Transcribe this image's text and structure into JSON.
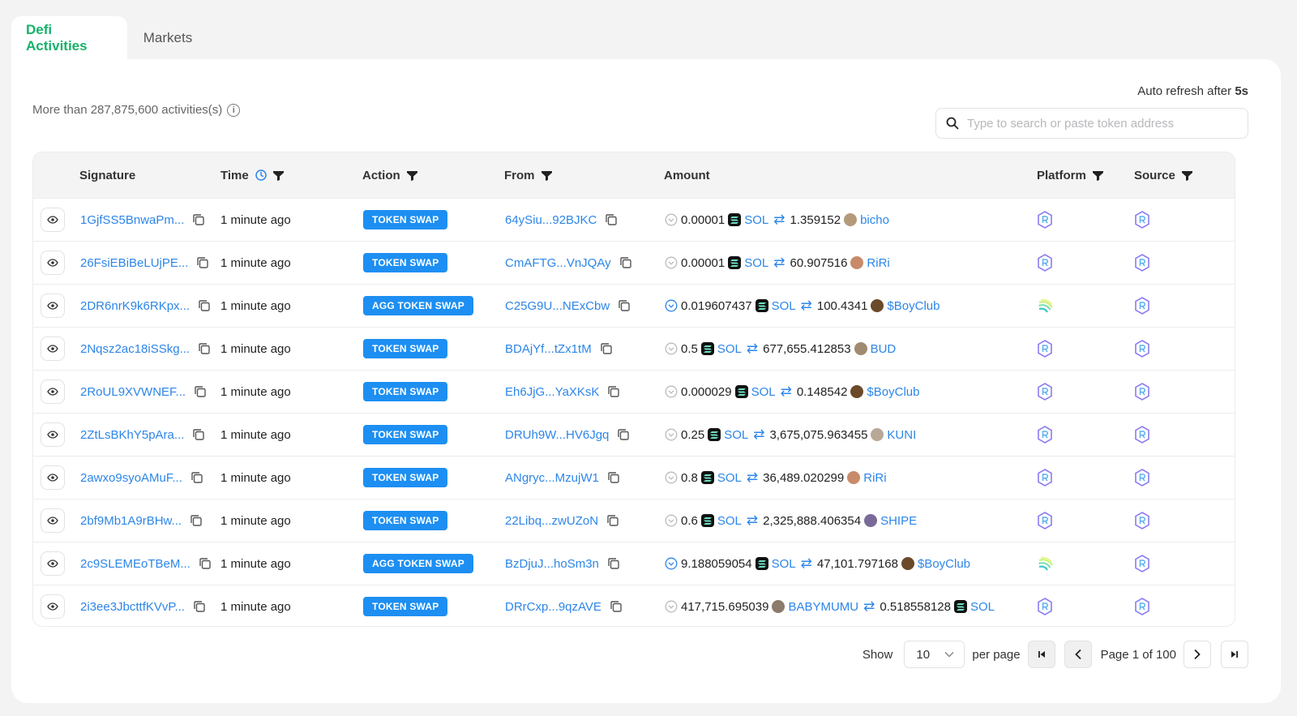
{
  "tabs": [
    {
      "label": "Defi Activities"
    },
    {
      "label": "Markets"
    }
  ],
  "summary": {
    "text": "More than 287,875,600 activities(s)"
  },
  "refresh": {
    "prefix": "Auto refresh after ",
    "value": "5s"
  },
  "search": {
    "placeholder": "Type to search or paste token address"
  },
  "columns": {
    "signature": "Signature",
    "time": "Time",
    "action": "Action",
    "from": "From",
    "amount": "Amount",
    "platform": "Platform",
    "source": "Source"
  },
  "colors": {
    "accent_green": "#17b26a",
    "link_blue": "#2d86e8",
    "badge_blue": "#1d8ff2"
  },
  "rows": [
    {
      "sig": "1GjfSS5BnwaPm...",
      "time": "1 minute ago",
      "action": "TOKEN SWAP",
      "from": "64ySiu...92BJKC",
      "a1": "0.00001",
      "t1": "SOL",
      "a2": "1.359152",
      "t2": "bicho",
      "t2color": "#b59a7a",
      "platform": "raydium",
      "highlight": false
    },
    {
      "sig": "26FsiEBiBeLUjPE...",
      "time": "1 minute ago",
      "action": "TOKEN SWAP",
      "from": "CmAFTG...VnJQAy",
      "a1": "0.00001",
      "t1": "SOL",
      "a2": "60.907516",
      "t2": "RiRi",
      "t2color": "#c98a6a",
      "platform": "raydium",
      "highlight": false
    },
    {
      "sig": "2DR6nrK9k6RKpx...",
      "time": "1 minute ago",
      "action": "AGG TOKEN SWAP",
      "from": "C25G9U...NExCbw",
      "a1": "0.019607437",
      "t1": "SOL",
      "a2": "100.4341",
      "t2": "$BoyClub",
      "t2color": "#6b4a2a",
      "platform": "jupiter",
      "highlight": true
    },
    {
      "sig": "2Nqsz2ac18iSSkg...",
      "time": "1 minute ago",
      "action": "TOKEN SWAP",
      "from": "BDAjYf...tZx1tM",
      "a1": "0.5",
      "t1": "SOL",
      "a2": "677,655.412853",
      "t2": "BUD",
      "t2color": "#a08a70",
      "platform": "raydium",
      "highlight": false
    },
    {
      "sig": "2RoUL9XVWNEF...",
      "time": "1 minute ago",
      "action": "TOKEN SWAP",
      "from": "Eh6JjG...YaXKsK",
      "a1": "0.000029",
      "t1": "SOL",
      "a2": "0.148542",
      "t2": "$BoyClub",
      "t2color": "#6b4a2a",
      "platform": "raydium",
      "highlight": false
    },
    {
      "sig": "2ZtLsBKhY5pAra...",
      "time": "1 minute ago",
      "action": "TOKEN SWAP",
      "from": "DRUh9W...HV6Jgq",
      "a1": "0.25",
      "t1": "SOL",
      "a2": "3,675,075.963455",
      "t2": "KUNI",
      "t2color": "#b8a898",
      "platform": "raydium",
      "highlight": false
    },
    {
      "sig": "2awxo9syoAMuF...",
      "time": "1 minute ago",
      "action": "TOKEN SWAP",
      "from": "ANgryc...MzujW1",
      "a1": "0.8",
      "t1": "SOL",
      "a2": "36,489.020299",
      "t2": "RiRi",
      "t2color": "#c98a6a",
      "platform": "raydium",
      "highlight": false
    },
    {
      "sig": "2bf9Mb1A9rBHw...",
      "time": "1 minute ago",
      "action": "TOKEN SWAP",
      "from": "22Libq...zwUZoN",
      "a1": "0.6",
      "t1": "SOL",
      "a2": "2,325,888.406354",
      "t2": "SHIPE",
      "t2color": "#7a6a9a",
      "platform": "raydium",
      "highlight": false
    },
    {
      "sig": "2c9SLEMEoTBeM...",
      "time": "1 minute ago",
      "action": "AGG TOKEN SWAP",
      "from": "BzDjuJ...hoSm3n",
      "a1": "9.188059054",
      "t1": "SOL",
      "a2": "47,101.797168",
      "t2": "$BoyClub",
      "t2color": "#6b4a2a",
      "platform": "jupiter",
      "highlight": true
    },
    {
      "sig": "2i3ee3JbcttfKVvP...",
      "time": "1 minute ago",
      "action": "TOKEN SWAP",
      "from": "DRrCxp...9qzAVE",
      "a1": "417,715.695039",
      "t1": "BABYMUMU",
      "a2": "0.518558128",
      "t2": "SOL",
      "t1first": true,
      "t2color": "#111",
      "platform": "raydium",
      "highlight": false
    }
  ],
  "pager": {
    "show": "Show",
    "per_page_value": "10",
    "per_page": "per page",
    "page_text": "Page 1 of 100"
  }
}
